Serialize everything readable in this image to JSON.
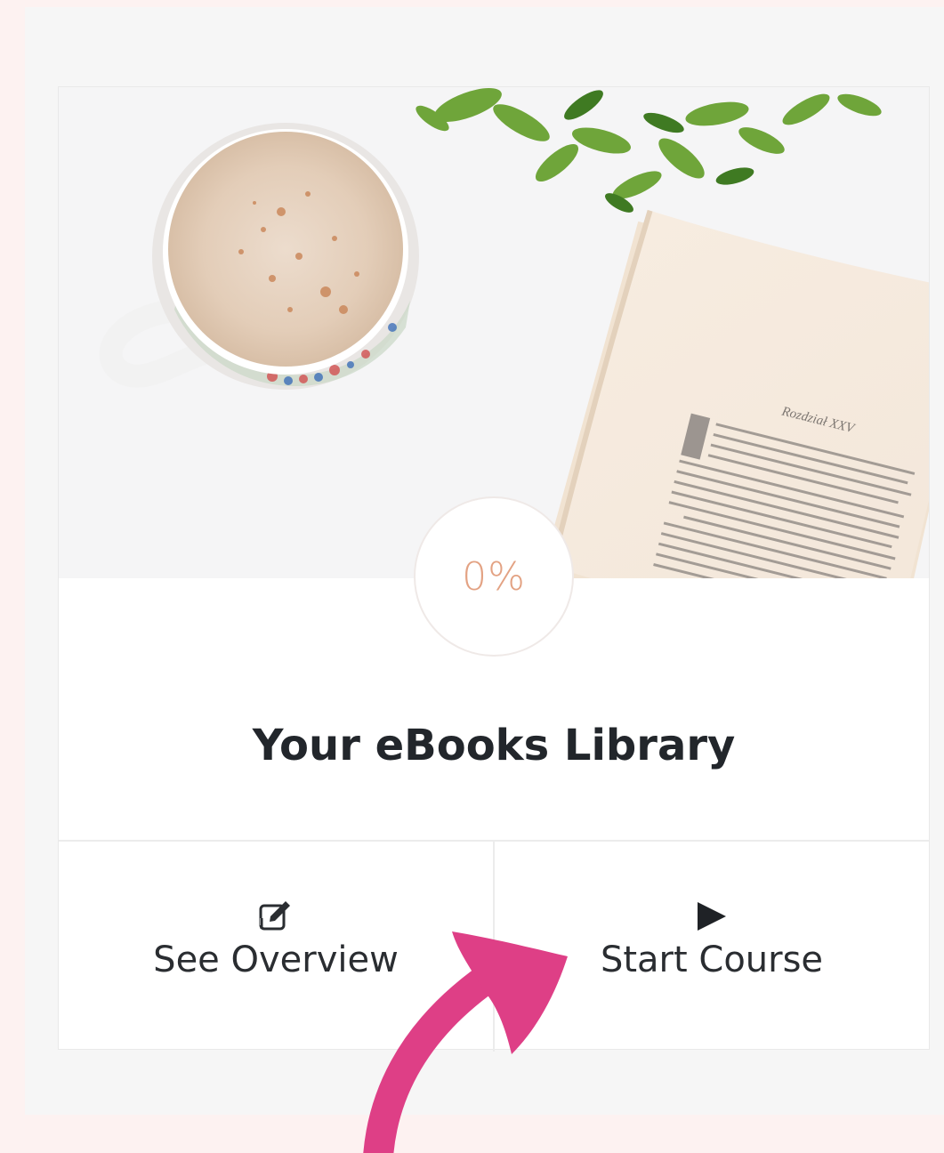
{
  "course_card": {
    "progress": "0%",
    "title": "Your eBooks Library",
    "actions": [
      {
        "label": "See Overview",
        "icon": "edit-icon"
      },
      {
        "label": "Start Course",
        "icon": "play-icon"
      }
    ]
  },
  "hero_image": {
    "book_heading": "Rozdział XXV"
  },
  "colors": {
    "progress_text": "#e3a283",
    "title_text": "#22262b",
    "annotation_arrow": "#de3f86"
  }
}
